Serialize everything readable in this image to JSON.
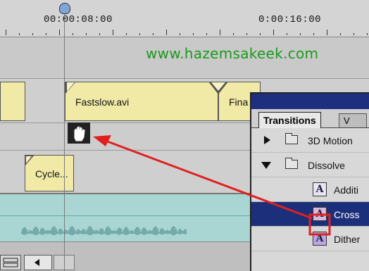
{
  "ruler": {
    "labels": [
      "00:00:08:00",
      "0:00:16:00"
    ]
  },
  "watermark": "www.hazemsakeek.com",
  "tracks": {
    "clip_fastslow": "Fastslow.avi",
    "clip_fina": "Fina",
    "clip_cycle": "Cycle..."
  },
  "panel": {
    "tab_active": "Transitions",
    "tab_next": "V",
    "items": [
      {
        "label": "3D Motion",
        "kind": "folder",
        "expanded": false
      },
      {
        "label": "Dissolve",
        "kind": "folder",
        "expanded": true
      },
      {
        "label": "Additi",
        "kind": "transition"
      },
      {
        "label": "Cross",
        "kind": "transition",
        "selected": true
      },
      {
        "label": "Dither",
        "kind": "transition"
      }
    ]
  },
  "colors": {
    "clip": "#f0eaa6",
    "audio": "#a9d6d2",
    "selection": "#1c2f7a",
    "arrow": "#e02020",
    "watermark": "#1a9a1a"
  }
}
